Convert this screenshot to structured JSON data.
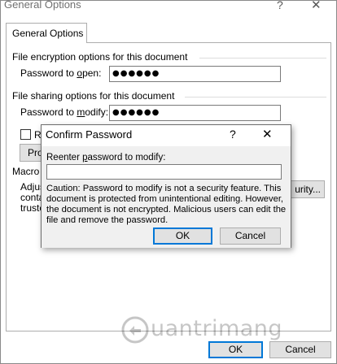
{
  "window": {
    "title": "General Options",
    "help_glyph": "?",
    "close_glyph": "✕"
  },
  "tab": {
    "label": "General Options"
  },
  "encryption": {
    "heading": "File encryption options for this document",
    "label_before": "Password to ",
    "label_underlined": "o",
    "label_after": "pen:",
    "value": "●●●●●●"
  },
  "sharing": {
    "heading": "File sharing options for this document",
    "label_before": "Password to ",
    "label_underlined": "m",
    "label_after": "odify:",
    "value": "●●●●●●",
    "readonly_partial": "Re",
    "protect_partial": "Pro"
  },
  "macro": {
    "heading_partial": "Macro s",
    "lines_partial": [
      "Adjus",
      "conta",
      "truste"
    ],
    "button_partial": "urity..."
  },
  "dialog": {
    "title": "Confirm Password",
    "help_glyph": "?",
    "close_glyph": "✕",
    "label_before": "Reenter ",
    "label_underlined": "p",
    "label_after": "assword to modify:",
    "input_value": "",
    "caution": "Caution: Password to modify is not a security feature. This document is protected from unintentional editing. However, the document is not encrypted. Malicious users can edit the file and remove the password.",
    "ok_label": "OK",
    "cancel_label": "Cancel"
  },
  "footer": {
    "ok_label": "OK",
    "cancel_label": "Cancel"
  },
  "watermark": {
    "brand_letter": "Q",
    "text": "uantrimang"
  },
  "colors": {
    "default_button_border": "#0078d7",
    "button_face": "#e1e1e1",
    "dialog_body": "#f0f0f0"
  }
}
